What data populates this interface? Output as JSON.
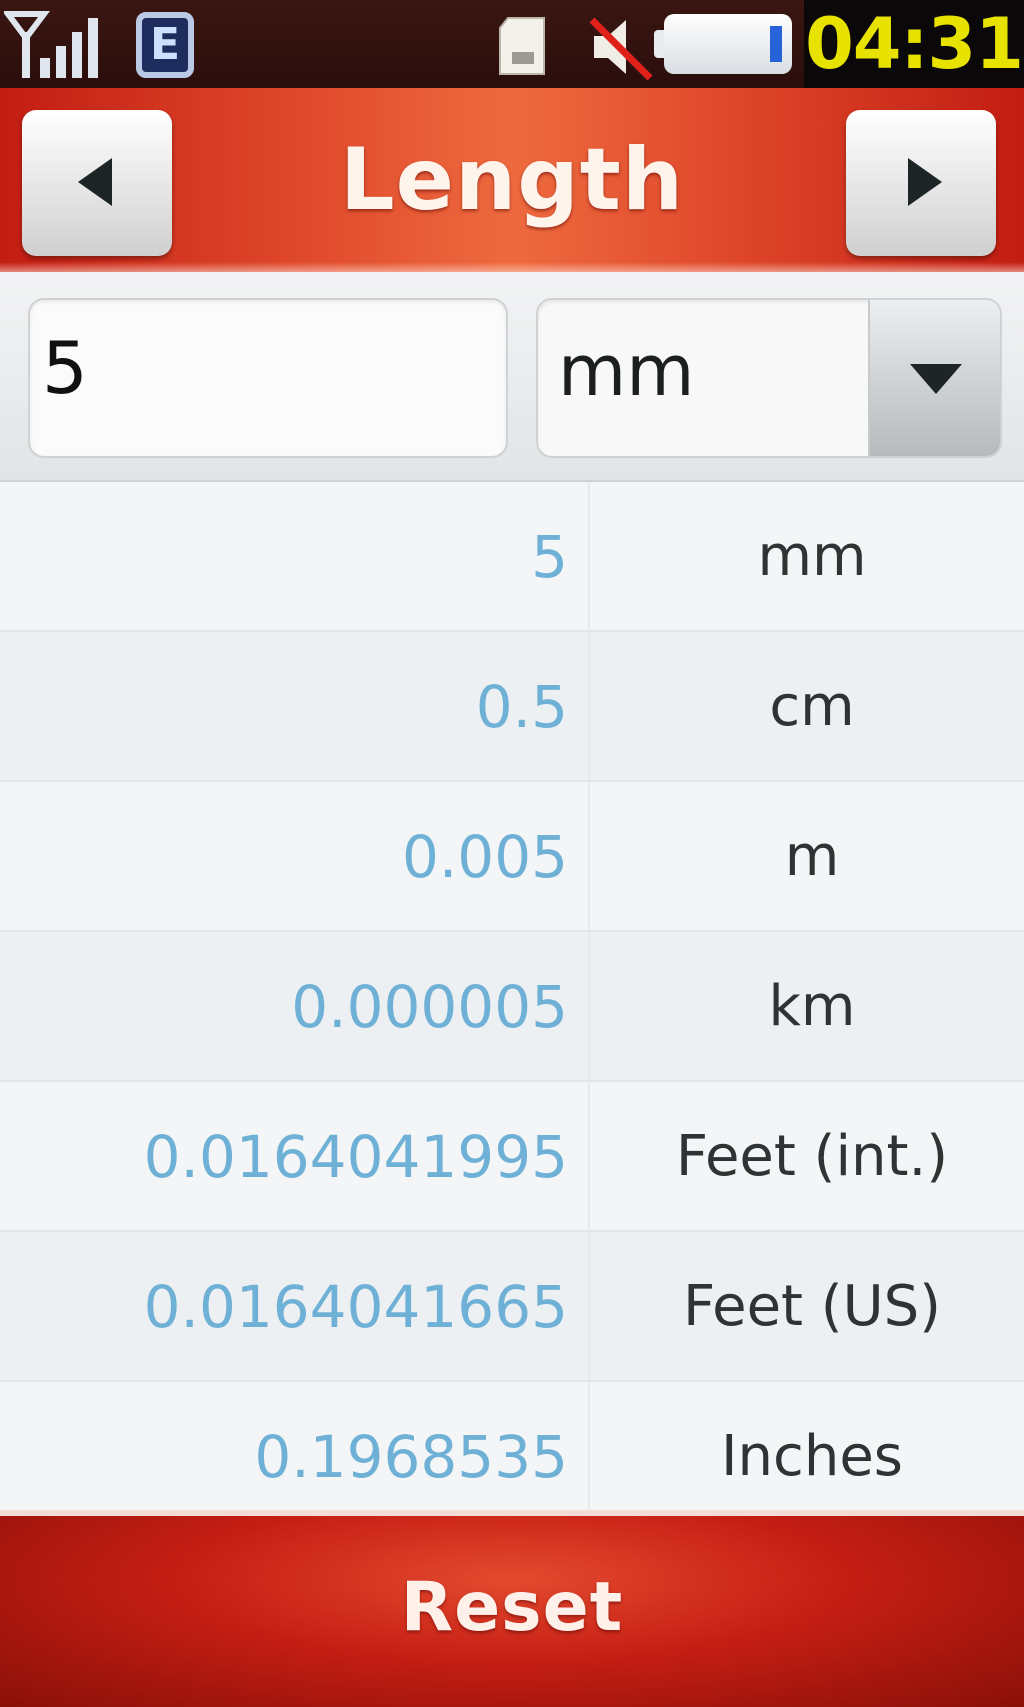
{
  "status_bar": {
    "network_type": "E",
    "time": "04:31",
    "icons": [
      "signal-strength-icon",
      "network-edge-icon",
      "sim-card-icon",
      "mute-icon",
      "battery-icon"
    ]
  },
  "header": {
    "title": "Length",
    "prev_icon": "left-arrow-icon",
    "next_icon": "right-arrow-icon"
  },
  "input": {
    "value": "5",
    "unit": "mm",
    "dropdown_icon": "chevron-down-icon"
  },
  "results": [
    {
      "value": "5",
      "unit": "mm"
    },
    {
      "value": "0.5",
      "unit": "cm"
    },
    {
      "value": "0.005",
      "unit": "m"
    },
    {
      "value": "0.000005",
      "unit": "km"
    },
    {
      "value": "0.0164041995",
      "unit": "Feet (int.)"
    },
    {
      "value": "0.0164041665",
      "unit": "Feet (US)"
    },
    {
      "value": "0.1968535",
      "unit": "Inches"
    }
  ],
  "footer": {
    "reset_label": "Reset"
  },
  "colors": {
    "accent_red": "#c21d12",
    "result_value": "#6fb1d6",
    "clock_text": "#e8e200"
  }
}
